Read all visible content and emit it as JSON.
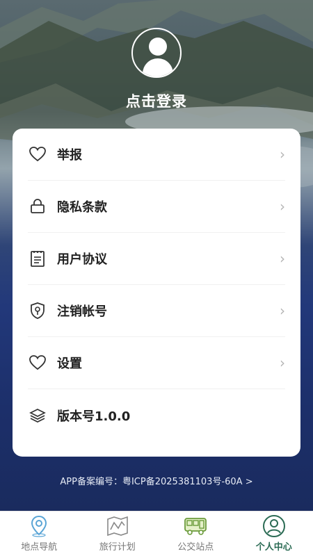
{
  "profile": {
    "login_label": "点击登录"
  },
  "menu": [
    {
      "label": "举报",
      "icon": "heart-icon",
      "chevron": "›"
    },
    {
      "label": "隐私条款",
      "icon": "lock-icon",
      "chevron": "›"
    },
    {
      "label": "用户协议",
      "icon": "document-icon",
      "chevron": "›"
    },
    {
      "label": "注销帐号",
      "icon": "shield-key-icon",
      "chevron": "›"
    },
    {
      "label": "设置",
      "icon": "heart-icon",
      "chevron": "›"
    },
    {
      "label": "版本号1.0.0",
      "icon": "layers-icon"
    }
  ],
  "footer": {
    "icp": "APP备案编号：粤ICP备2025381103号-60A >"
  },
  "tabbar": [
    {
      "label": "地点导航",
      "icon": "location-pin-icon",
      "active": false
    },
    {
      "label": "旅行计划",
      "icon": "map-icon",
      "active": false
    },
    {
      "label": "公交站点",
      "icon": "bus-icon",
      "active": false
    },
    {
      "label": "个人中心",
      "icon": "user-icon",
      "active": true
    }
  ],
  "colors": {
    "accent": "#2b6b54",
    "background": "#1a2d5a",
    "card": "#ffffff"
  }
}
